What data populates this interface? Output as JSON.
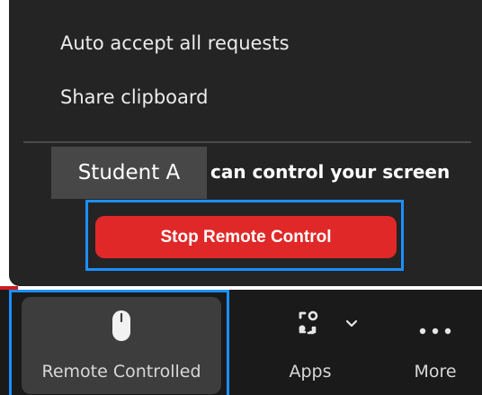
{
  "menu": {
    "items": [
      {
        "label": "Auto accept all requests"
      },
      {
        "label": "Share clipboard"
      }
    ]
  },
  "remote_control": {
    "controller_name": "Student A",
    "message": "can control your screen",
    "stop_label": "Stop Remote Control"
  },
  "toolbar": {
    "remote_controlled": {
      "label": "Remote Controlled",
      "icon": "mouse-icon"
    },
    "apps": {
      "label": "Apps",
      "icon": "apps-icon"
    },
    "more": {
      "label": "More",
      "icon": "more-dots-icon"
    }
  },
  "colors": {
    "popup_bg": "#242424",
    "toolbar_bg": "#1a1a1a",
    "stop_button": "#e02828",
    "highlight": "#1c8fff"
  }
}
